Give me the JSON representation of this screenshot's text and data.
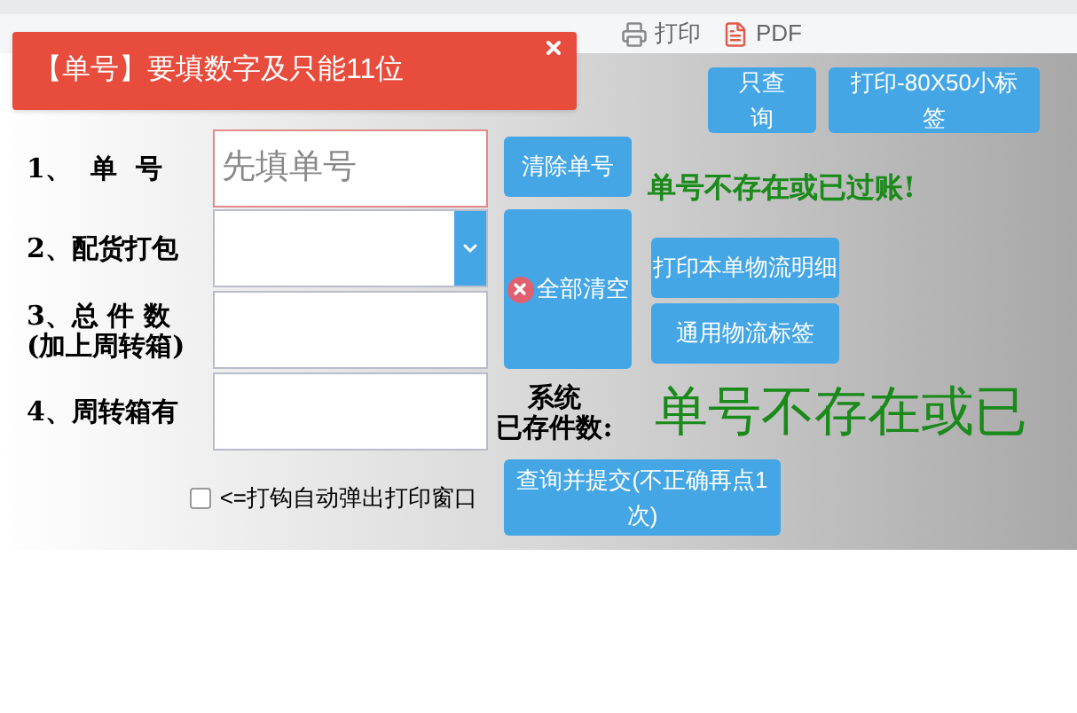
{
  "toolbar": [
    {
      "kind": "print",
      "label": "打印"
    },
    {
      "kind": "pdf",
      "label": "PDF"
    }
  ],
  "toast": {
    "message": "【单号】要填数字及只能11位"
  },
  "top_buttons": [
    "只查询",
    "打印-80X50小标签"
  ],
  "fields": [
    {
      "kind": "input",
      "label": "1、  单  号",
      "placeholder": "先填单号"
    },
    {
      "kind": "select",
      "label": "2、配货打包"
    },
    {
      "kind": "input",
      "label": "3、总 件 数",
      "sublabel": "(加上周转箱)"
    },
    {
      "kind": "input",
      "label": "4、周转箱有"
    }
  ],
  "clear_number_button": "清除单号",
  "clear_all_button": "全部清空",
  "status_message": "单号不存在或已过账!",
  "print_buttons": [
    "打印本单物流明细",
    "通用物流标签"
  ],
  "stored_label": [
    "系统",
    "已存件数:"
  ],
  "stored_value": "单号不存在或已",
  "auto_print": {
    "label": "<=打钩自动弹出打印窗口",
    "checked": false
  },
  "submit_button": "查询并提交(不正确再点1次)"
}
